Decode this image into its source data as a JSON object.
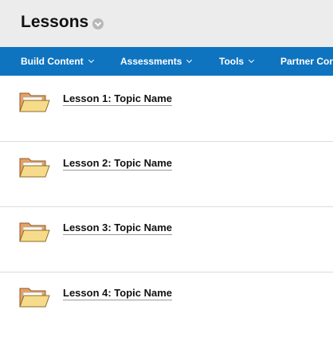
{
  "header": {
    "title": "Lessons"
  },
  "nav": {
    "items": [
      {
        "label": "Build Content"
      },
      {
        "label": "Assessments"
      },
      {
        "label": "Tools"
      },
      {
        "label": "Partner Con"
      }
    ]
  },
  "lessons": [
    {
      "title": "Lesson 1: Topic Name"
    },
    {
      "title": "Lesson 2: Topic Name"
    },
    {
      "title": "Lesson 3: Topic Name"
    },
    {
      "title": "Lesson 4: Topic Name"
    }
  ],
  "colors": {
    "nav_background": "#0f74bf",
    "header_background": "#ececec",
    "folder_body": "#f6dc8a",
    "folder_tab": "#e8a060"
  },
  "icons": {
    "title_menu": "chevron-down-circle-icon",
    "nav_dropdown": "chevron-down-icon",
    "lesson_item": "folder-open-icon"
  }
}
